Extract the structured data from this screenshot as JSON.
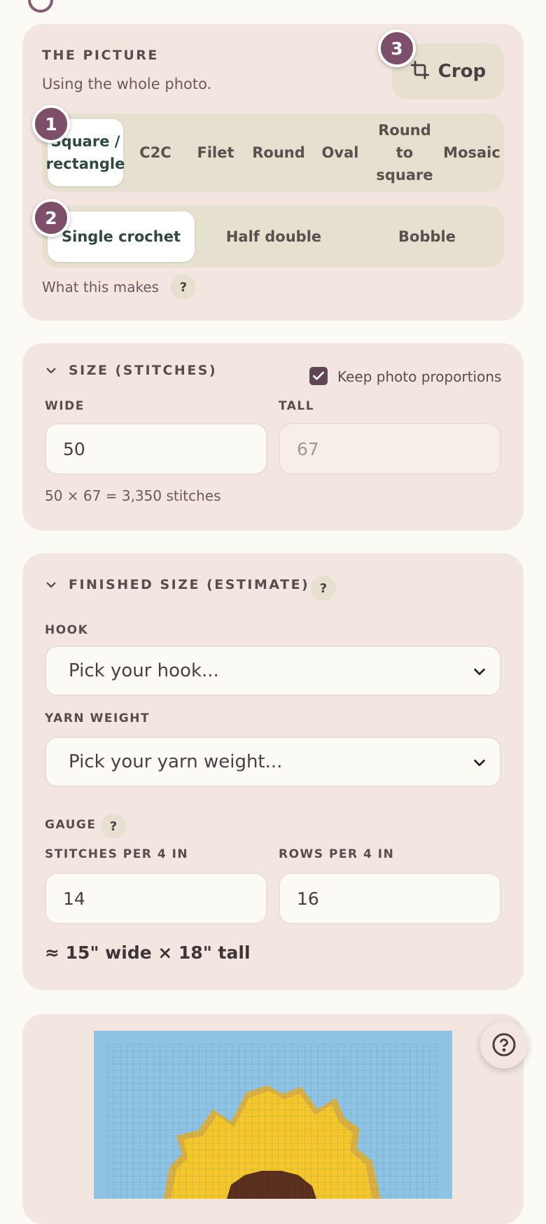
{
  "picture": {
    "heading": "THE PICTURE",
    "subtitle": "Using the whole photo.",
    "crop_label": "Crop",
    "styles": [
      "Square / rectangle",
      "C2C",
      "Filet",
      "Round",
      "Oval",
      "Round to square",
      "Mosaic"
    ],
    "stitches": [
      "Single crochet",
      "Half double",
      "Bobble"
    ],
    "what_this_makes": "What this makes",
    "help": "?",
    "badges": [
      "1",
      "2",
      "3"
    ]
  },
  "size": {
    "heading": "SIZE (STITCHES)",
    "keep_proportions": "Keep photo proportions",
    "keep_proportions_checked": true,
    "wide_label": "WIDE",
    "tall_label": "TALL",
    "wide_value": "50",
    "tall_value": "67",
    "total": "50 × 67 = 3,350 stitches"
  },
  "finished": {
    "heading": "FINISHED SIZE (ESTIMATE)",
    "help": "?",
    "hook_label": "HOOK",
    "hook_placeholder": "Pick your hook...",
    "yarn_label": "YARN WEIGHT",
    "yarn_placeholder": "Pick your yarn weight...",
    "gauge_label": "GAUGE",
    "gauge_help": "?",
    "stitches_label": "STITCHES PER 4 IN",
    "rows_label": "ROWS PER 4 IN",
    "stitches_value": "14",
    "rows_value": "16",
    "result": "≈ 15\" wide × 18\" tall"
  },
  "preview": {
    "colors": {
      "sky": "#8ec3e3",
      "petal": "#f6c72b",
      "petal_edge": "#d9b041",
      "center": "#5a2e1a",
      "grid": "#3d6e8c"
    }
  },
  "colors": {
    "accent": "#7e4f68",
    "card": "#f3e6e0",
    "page": "#fcfaf5",
    "active_text": "#2e4a3c"
  }
}
